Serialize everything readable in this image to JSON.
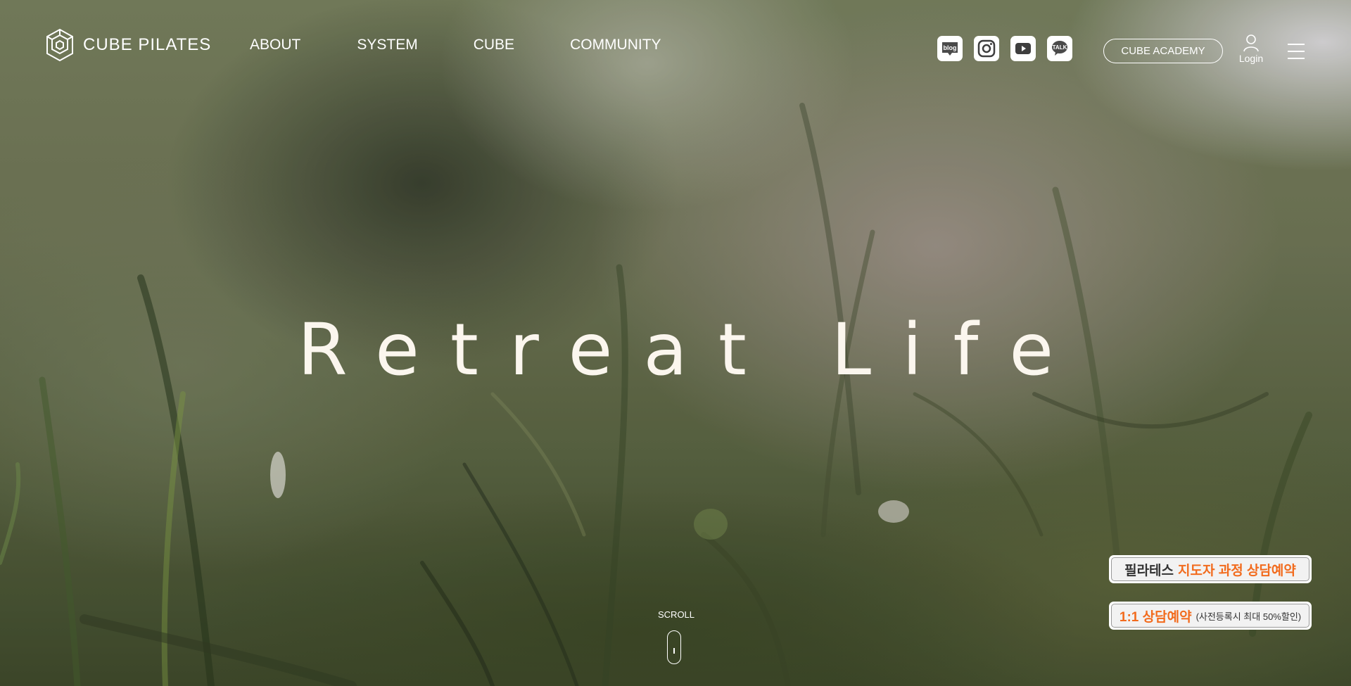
{
  "brand": {
    "name": "CUBE PILATES",
    "icon": "cube-logo-icon"
  },
  "nav": {
    "items": [
      {
        "label": "ABOUT"
      },
      {
        "label": "SYSTEM"
      },
      {
        "label": "CUBE"
      },
      {
        "label": "COMMUNITY"
      }
    ]
  },
  "social": [
    {
      "icon": "blog-icon",
      "label": "blog"
    },
    {
      "icon": "instagram-icon"
    },
    {
      "icon": "youtube-icon"
    },
    {
      "icon": "kakaotalk-icon",
      "label": "TALK"
    }
  ],
  "header": {
    "academy_label": "CUBE ACADEMY",
    "login_label": "Login",
    "menu_icon": "hamburger-menu-icon"
  },
  "hero": {
    "title": "Retreat Life"
  },
  "scroll": {
    "label": "SCROLL"
  },
  "cta": {
    "instructor": {
      "prefix": "필라테스",
      "highlight": "지도자 과정 상담예약"
    },
    "consult": {
      "highlight": "1:1 상담예약",
      "note": "(사전등록시 최대 50%할인)"
    }
  },
  "colors": {
    "accent": "#f26b1d",
    "hero_text": "#fbf6ee"
  }
}
